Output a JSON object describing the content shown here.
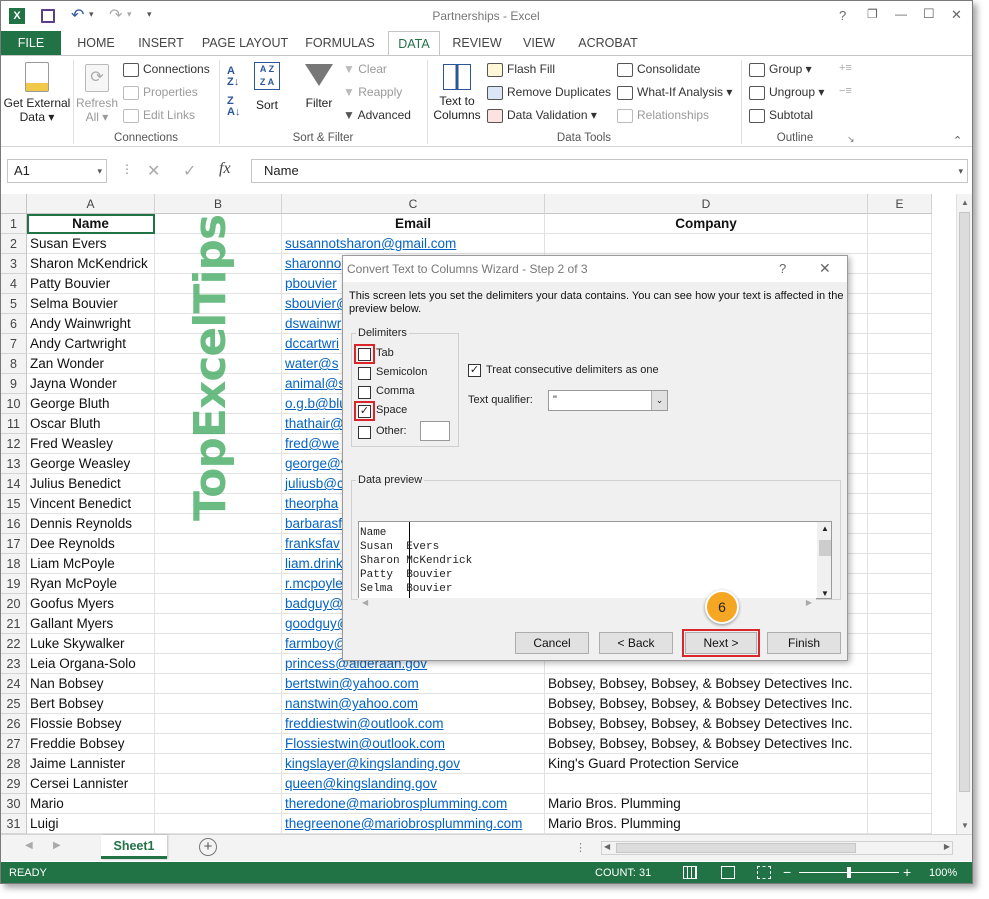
{
  "title": "Partnerships - Excel",
  "titlebar_icons": {
    "help": "?",
    "restore": "❐",
    "minimize": "—",
    "maximize": "☐",
    "close": "✕"
  },
  "ribbon_tabs": [
    "FILE",
    "HOME",
    "INSERT",
    "PAGE LAYOUT",
    "FORMULAS",
    "DATA",
    "REVIEW",
    "VIEW",
    "ACROBAT"
  ],
  "active_tab": "DATA",
  "ribbon": {
    "get_external_1": "Get External",
    "get_external_2": "Data ▾",
    "refresh_1": "Refresh",
    "refresh_2": "All ▾",
    "connections": "Connections",
    "properties": "Properties",
    "edit_links": "Edit Links",
    "grp_connections": "Connections",
    "sort": "Sort",
    "filter": "Filter",
    "clear": "Clear",
    "reapply": "Reapply",
    "advanced": "Advanced",
    "grp_sortfilter": "Sort & Filter",
    "text_to_columns_1": "Text to",
    "text_to_columns_2": "Columns",
    "flash_fill": "Flash Fill",
    "remove_duplicates": "Remove Duplicates",
    "data_validation": "Data Validation ▾",
    "consolidate": "Consolidate",
    "whatif": "What-If Analysis ▾",
    "relationships": "Relationships",
    "grp_datatools": "Data Tools",
    "group": "Group ▾",
    "ungroup": "Ungroup ▾",
    "subtotal": "Subtotal",
    "grp_outline": "Outline"
  },
  "formula_bar": {
    "name_box": "A1",
    "fx": "fx",
    "value": "Name"
  },
  "columns": [
    "A",
    "B",
    "C",
    "D",
    "E"
  ],
  "rows": [
    {
      "n": "1",
      "a": "Name",
      "c": "Email",
      "d": "Company"
    },
    {
      "n": "2",
      "a": "Susan Evers",
      "c": "susannotsharon@gmail.com",
      "d": ""
    },
    {
      "n": "3",
      "a": "Sharon McKendrick",
      "c": "sharonno",
      "d": ""
    },
    {
      "n": "4",
      "a": "Patty Bouvier",
      "c": "pbouvier",
      "d": ""
    },
    {
      "n": "5",
      "a": "Selma Bouvier",
      "c": "sbouvier@",
      "d": ""
    },
    {
      "n": "6",
      "a": "Andy Wainwright",
      "c": "dswainwr",
      "d": ""
    },
    {
      "n": "7",
      "a": "Andy Cartwright",
      "c": "dccartwri",
      "d": ""
    },
    {
      "n": "8",
      "a": "Zan Wonder",
      "c": "water@s",
      "d": ""
    },
    {
      "n": "9",
      "a": "Jayna Wonder",
      "c": "animal@s",
      "d": ""
    },
    {
      "n": "10",
      "a": "George Bluth",
      "c": "o.g.b@blu",
      "d": ""
    },
    {
      "n": "11",
      "a": "Oscar Bluth",
      "c": "thathair@",
      "d": ""
    },
    {
      "n": "12",
      "a": "Fred Weasley",
      "c": "fred@we",
      "d": ""
    },
    {
      "n": "13",
      "a": "George Weasley",
      "c": "george@v",
      "d": ""
    },
    {
      "n": "14",
      "a": "Julius Benedict",
      "c": "juliusb@c",
      "d": ""
    },
    {
      "n": "15",
      "a": "Vincent Benedict",
      "c": "theorpha",
      "d": ""
    },
    {
      "n": "16",
      "a": "Dennis Reynolds",
      "c": "barbarasf",
      "d": ""
    },
    {
      "n": "17",
      "a": "Dee Reynolds",
      "c": "franksfav",
      "d": ""
    },
    {
      "n": "18",
      "a": "Liam McPoyle",
      "c": "liam.drink",
      "d": ""
    },
    {
      "n": "19",
      "a": "Ryan McPoyle",
      "c": "r.mcpoyle",
      "d": ""
    },
    {
      "n": "20",
      "a": "Goofus Myers",
      "c": "badguy@",
      "d": ""
    },
    {
      "n": "21",
      "a": "Gallant Myers",
      "c": "goodguy@",
      "d": ""
    },
    {
      "n": "22",
      "a": "Luke Skywalker",
      "c": "farmboy@",
      "d": ""
    },
    {
      "n": "23",
      "a": "Leia Organa-Solo",
      "c": "princess@alderaan.gov",
      "d": ""
    },
    {
      "n": "24",
      "a": "Nan Bobsey",
      "c": "bertstwin@yahoo.com",
      "d": "Bobsey, Bobsey, Bobsey, & Bobsey Detectives Inc."
    },
    {
      "n": "25",
      "a": "Bert Bobsey",
      "c": "nanstwin@yahoo.com",
      "d": "Bobsey, Bobsey, Bobsey, & Bobsey Detectives Inc."
    },
    {
      "n": "26",
      "a": "Flossie Bobsey",
      "c": "freddiestwin@outlook.com",
      "d": "Bobsey, Bobsey, Bobsey, & Bobsey Detectives Inc."
    },
    {
      "n": "27",
      "a": "Freddie Bobsey",
      "c": "Flossiestwin@outlook.com",
      "d": "Bobsey, Bobsey, Bobsey, & Bobsey Detectives Inc."
    },
    {
      "n": "28",
      "a": "Jaime Lannister",
      "c": "kingslayer@kingslanding.gov",
      "d": "King's Guard Protection Service"
    },
    {
      "n": "29",
      "a": "Cersei Lannister",
      "c": "queen@kingslanding.gov",
      "d": ""
    },
    {
      "n": "30",
      "a": "Mario",
      "c": "theredone@mariobrosplumming.com",
      "d": "Mario Bros. Plumming"
    },
    {
      "n": "31",
      "a": "Luigi",
      "c": "thegreenone@mariobrosplumming.com",
      "d": "Mario Bros. Plumming"
    }
  ],
  "watermark": "TopExcelTips",
  "dialog": {
    "title": "Convert Text to Columns Wizard - Step 2 of 3",
    "help": "?",
    "close": "✕",
    "description": "This screen lets you set the delimiters your data contains.  You can see how your text is affected in the preview below.",
    "delimiters_label": "Delimiters",
    "tab": "Tab",
    "semicolon": "Semicolon",
    "comma": "Comma",
    "space": "Space",
    "other": "Other:",
    "treat_consecutive": "Treat consecutive delimiters as one",
    "text_qualifier_label": "Text qualifier:",
    "text_qualifier_value": "\"",
    "data_preview_label": "Data preview",
    "preview_lines": [
      "Name",
      "Susan  Evers",
      "Sharon McKendrick",
      "Patty  Bouvier",
      "Selma  Bouvier"
    ],
    "cancel": "Cancel",
    "back": "< Back",
    "next": "Next >",
    "finish": "Finish",
    "step_badge": "6"
  },
  "sheet_tab": "Sheet1",
  "status": {
    "ready": "READY",
    "count": "COUNT: 31",
    "zoom": "100%"
  }
}
